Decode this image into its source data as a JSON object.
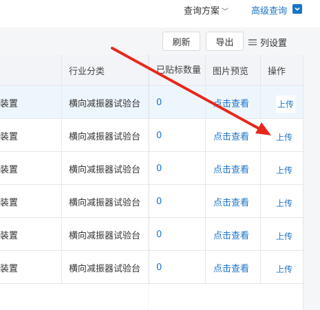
{
  "topbar": {
    "query_scheme": "查询方案",
    "advanced_query": "高级查询"
  },
  "toolbar": {
    "refresh": "刷新",
    "export": "导出",
    "column_settings": "列设置"
  },
  "table": {
    "headers": {
      "industry": "行业分类",
      "count": "已贴标数量",
      "preview": "图片预览",
      "ops": "操作"
    },
    "rows": [
      {
        "device": "装置",
        "industry": "横向减振器试验台",
        "count": "0",
        "preview": "点击查看",
        "op": "上传"
      },
      {
        "device": "装置",
        "industry": "横向减振器试验台",
        "count": "0",
        "preview": "点击查看",
        "op": "上传"
      },
      {
        "device": "装置",
        "industry": "横向减振器试验台",
        "count": "0",
        "preview": "点击查看",
        "op": "上传"
      },
      {
        "device": "装置",
        "industry": "横向减振器试验台",
        "count": "0",
        "preview": "点击查看",
        "op": "上传"
      },
      {
        "device": "装置",
        "industry": "横向减振器试验台",
        "count": "0",
        "preview": "点击查看",
        "op": "上传"
      },
      {
        "device": "装置",
        "industry": "横向减振器试验台",
        "count": "0",
        "preview": "点击查看",
        "op": "上传"
      }
    ]
  },
  "colors": {
    "accent": "#1a73c9",
    "annotation_arrow": "#e8271c"
  },
  "annotation": {
    "icon": "red-arrow-annotation"
  }
}
